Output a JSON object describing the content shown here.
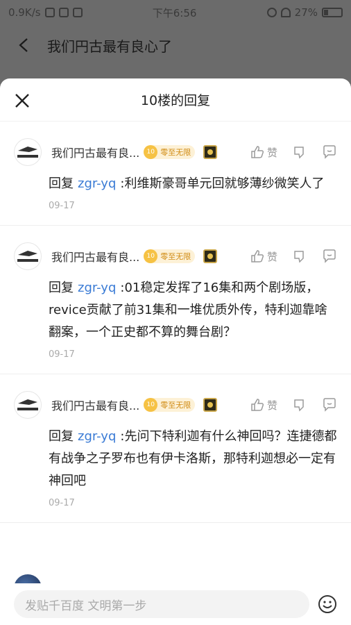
{
  "status_bar": {
    "network_speed": "0.9K/s",
    "time": "下午6:56",
    "battery": "27%"
  },
  "background_page": {
    "title": "我们円古最有良心了"
  },
  "sheet": {
    "title": "10楼的回复"
  },
  "replies": [
    {
      "username": "我们円古最有良...",
      "badge_level": "10",
      "badge_text": "零至无限",
      "like_label": "赞",
      "prefix": "回复",
      "reply_to": "zgr-yq",
      "text": ":利维斯豪哥单元回就够薄纱微笑人了",
      "date": "09-17"
    },
    {
      "username": "我们円古最有良...",
      "badge_level": "10",
      "badge_text": "零至无限",
      "like_label": "赞",
      "prefix": "回复",
      "reply_to": "zgr-yq",
      "text": ":01稳定发挥了16集和两个剧场版，revice贡献了前31集和一堆优质外传，特利迦靠啥翻案，一个正史都不算的舞台剧？",
      "date": "09-17"
    },
    {
      "username": "我们円古最有良...",
      "badge_level": "10",
      "badge_text": "零至无限",
      "like_label": "赞",
      "prefix": "回复",
      "reply_to": "zgr-yq",
      "text": ":先问下特利迦有什么神回吗？连捷德都有战争之子罗布也有伊卡洛斯，那特利迦想必一定有神回吧",
      "date": "09-17"
    }
  ],
  "input": {
    "placeholder": "发贴千百度 文明第一步"
  },
  "colors": {
    "link": "#3a7bd5",
    "badge_bg": "#fdf1d6",
    "badge_text": "#d08a12"
  }
}
